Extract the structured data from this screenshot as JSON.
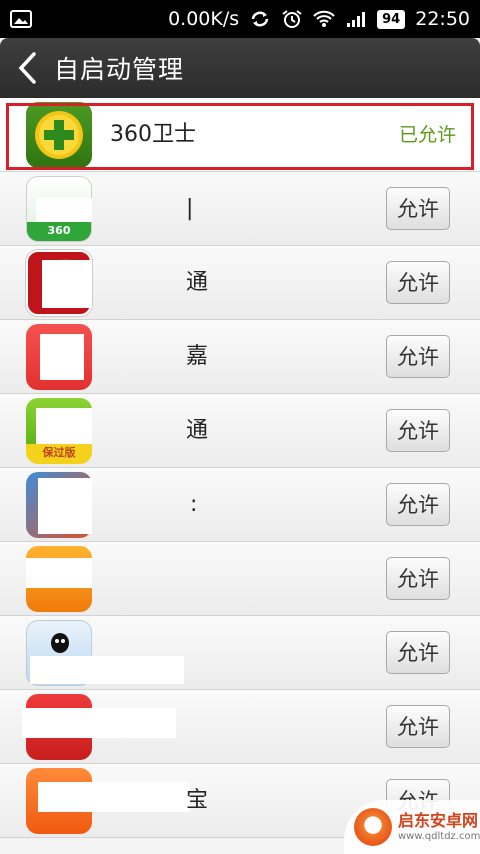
{
  "statusbar": {
    "net_speed": "0.00K/s",
    "battery": "94",
    "time": "22:50"
  },
  "header": {
    "title": "自启动管理"
  },
  "apps": [
    {
      "name": "360卫士",
      "status": "已允许"
    },
    {
      "name": "|",
      "button": "允许"
    },
    {
      "name": "通",
      "button": "允许"
    },
    {
      "name": "嘉",
      "button": "允许"
    },
    {
      "name": "通",
      "button": "允许"
    },
    {
      "name": ":",
      "button": "允许"
    },
    {
      "name": "",
      "button": "允许"
    },
    {
      "name": "",
      "button": "允许"
    },
    {
      "name": "",
      "button": "允许"
    },
    {
      "name": "宝",
      "button": "允许"
    }
  ],
  "watermark": {
    "title": "启东安卓网",
    "url": "www.qdltdz.com"
  },
  "colors": {
    "allowed": "#5a9a1c",
    "highlight": "#d8202a",
    "titlebar": "#333333"
  }
}
